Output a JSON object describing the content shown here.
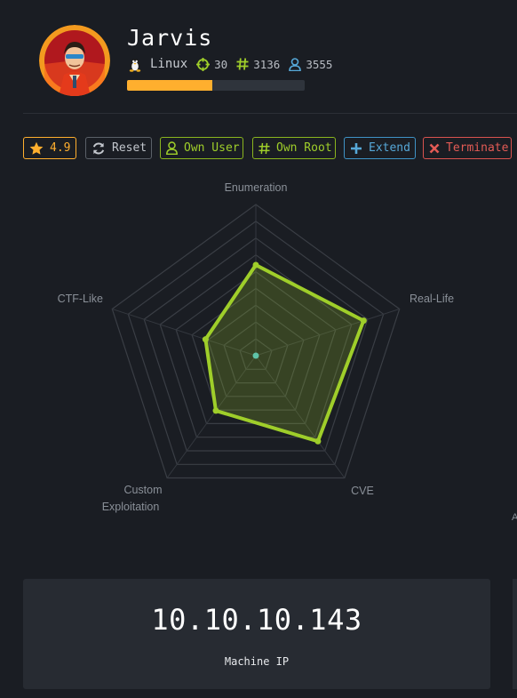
{
  "machine": {
    "name": "Jarvis",
    "os": "Linux",
    "points": "30",
    "user_owns": "3136",
    "root_owns": "3555",
    "progress_fraction": 0.48
  },
  "toolbar": {
    "rating": "4.9",
    "reset_label": "Reset",
    "own_user_label": "Own User",
    "own_root_label": "Own Root",
    "extend_label": "Extend",
    "terminate_label": "Terminate"
  },
  "radar": {
    "axes": [
      {
        "label": "Enumeration",
        "value": 0.6
      },
      {
        "label": "Real-Life",
        "value": 0.75
      },
      {
        "label": "CVE",
        "value": 0.7
      },
      {
        "label": "Custom Exploitation",
        "value": 0.45
      },
      {
        "label": "CTF-Like",
        "value": 0.35
      }
    ],
    "label_lines": {
      "custom_line1": "Custom",
      "custom_line2": "Exploitation"
    }
  },
  "ip": {
    "value": "10.10.10.143",
    "label": "Machine IP"
  },
  "colors": {
    "accent_orange": "#ffaf2e",
    "accent_green": "#9fce2a",
    "accent_blue": "#56a8d8",
    "accent_red": "#e35b55"
  },
  "icons": [
    "avatar",
    "linux-tux-icon",
    "crosshair-icon",
    "hash-icon",
    "user-icon",
    "star-icon",
    "refresh-icon",
    "plus-icon",
    "close-icon"
  ]
}
